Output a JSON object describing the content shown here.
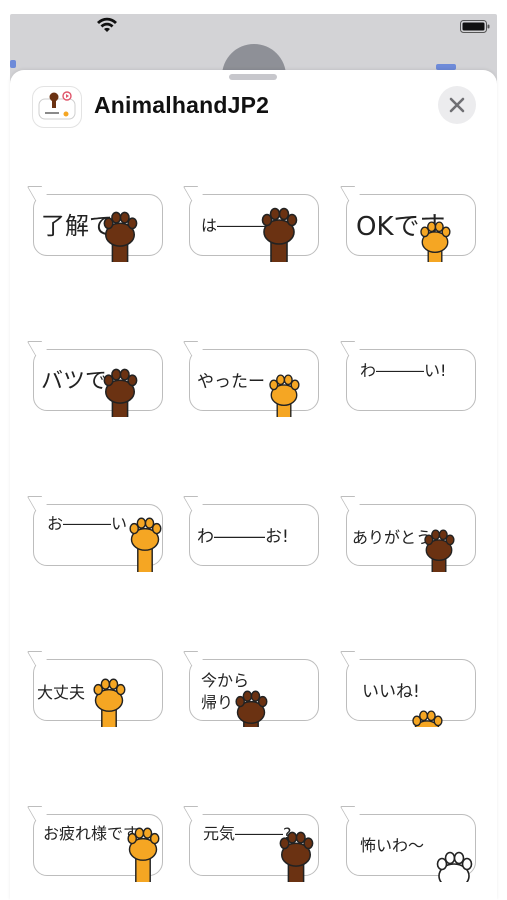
{
  "app": {
    "title": "AnimalhandJP2"
  },
  "colors": {
    "paw_brown": "#6b3212",
    "paw_orange": "#f5a623",
    "paw_white": "#ffffff",
    "outline": "#222222"
  },
  "stickers": [
    {
      "text": "了解で",
      "paw": "brown"
    },
    {
      "text": "は―――",
      "paw": "brown"
    },
    {
      "text": "OKです",
      "paw": "orange"
    },
    {
      "text": "バツで",
      "paw": "brown"
    },
    {
      "text": "やったー",
      "paw": "orange"
    },
    {
      "text": "わ―――い!",
      "paw": "none"
    },
    {
      "text": "お―――い",
      "paw": "orange"
    },
    {
      "text": "わ―――お!",
      "paw": "none"
    },
    {
      "text": "ありがとう",
      "paw": "brown"
    },
    {
      "text": "大丈夫",
      "paw": "orange"
    },
    {
      "text": "今から",
      "text2": "帰り",
      "paw": "brown"
    },
    {
      "text": "いいね!",
      "paw": "orange"
    },
    {
      "text": "お疲れ様です",
      "paw": "orange"
    },
    {
      "text": "元気―――?",
      "paw": "brown"
    },
    {
      "text": "怖いわ～",
      "paw": "white"
    }
  ]
}
